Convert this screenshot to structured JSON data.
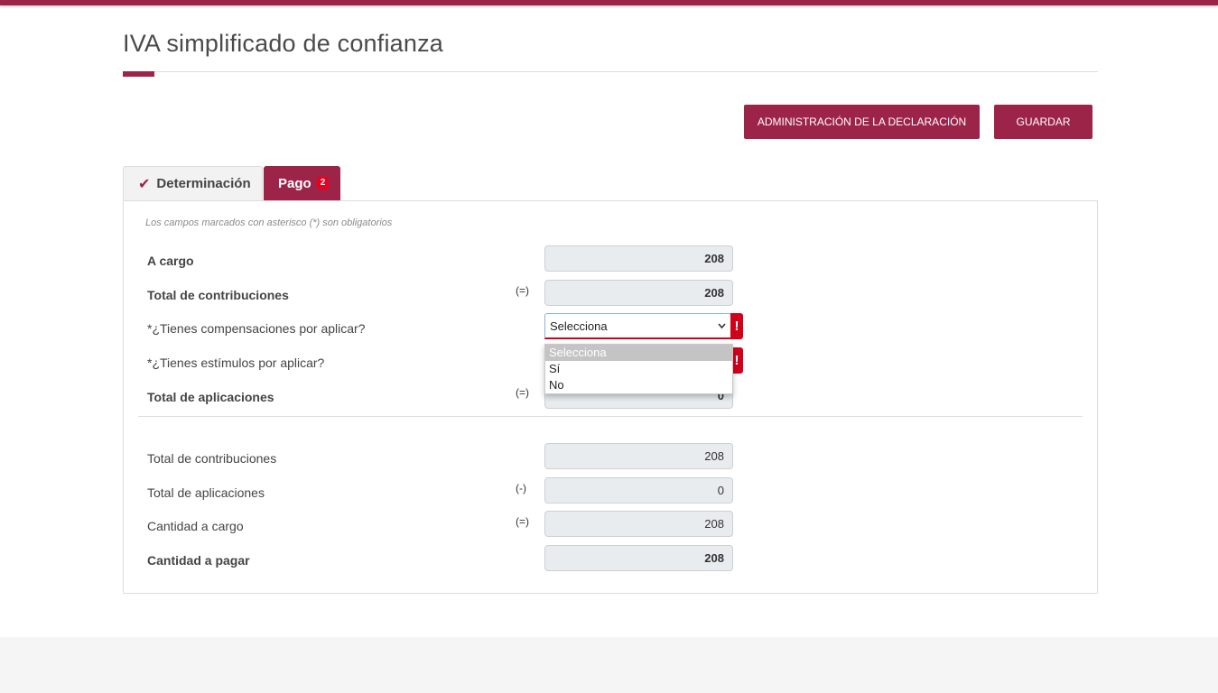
{
  "page": {
    "title": "IVA simplificado de confianza"
  },
  "toolbar": {
    "admin_label": "ADMINISTRACIÓN DE LA DECLARACIÓN",
    "save_label": "GUARDAR"
  },
  "tabs": [
    {
      "label": "Determinación",
      "icon": "check-icon"
    },
    {
      "label": "Pago",
      "badge": "2"
    }
  ],
  "form": {
    "note": "Los campos marcados con asterisco (*) son obligatorios",
    "a_cargo": {
      "label": "A cargo",
      "value": "208"
    },
    "total_contribuciones": {
      "label": "Total de contribuciones",
      "op": "(=)",
      "value": "208"
    },
    "compensaciones": {
      "label": "*¿Tienes compensaciones por aplicar?",
      "selected": "Selecciona",
      "warn": "!"
    },
    "estimulos": {
      "label": "*¿Tienes estímulos por aplicar?",
      "warn": "!"
    },
    "total_aplicaciones": {
      "label": "Total de aplicaciones",
      "op": "(=)",
      "value": "0"
    },
    "dropdown_options": [
      "Selecciona",
      "Sí",
      "No"
    ]
  },
  "summary": {
    "total_contribuciones": {
      "label": "Total de contribuciones",
      "value": "208"
    },
    "total_aplicaciones": {
      "label": "Total de aplicaciones",
      "op": "(-)",
      "value": "0"
    },
    "cantidad_cargo": {
      "label": "Cantidad a cargo",
      "op": "(=)",
      "value": "208"
    },
    "cantidad_pagar": {
      "label": "Cantidad a pagar",
      "value": "208"
    }
  },
  "colors": {
    "brand": "#9d2449",
    "alert": "#d0021b"
  }
}
